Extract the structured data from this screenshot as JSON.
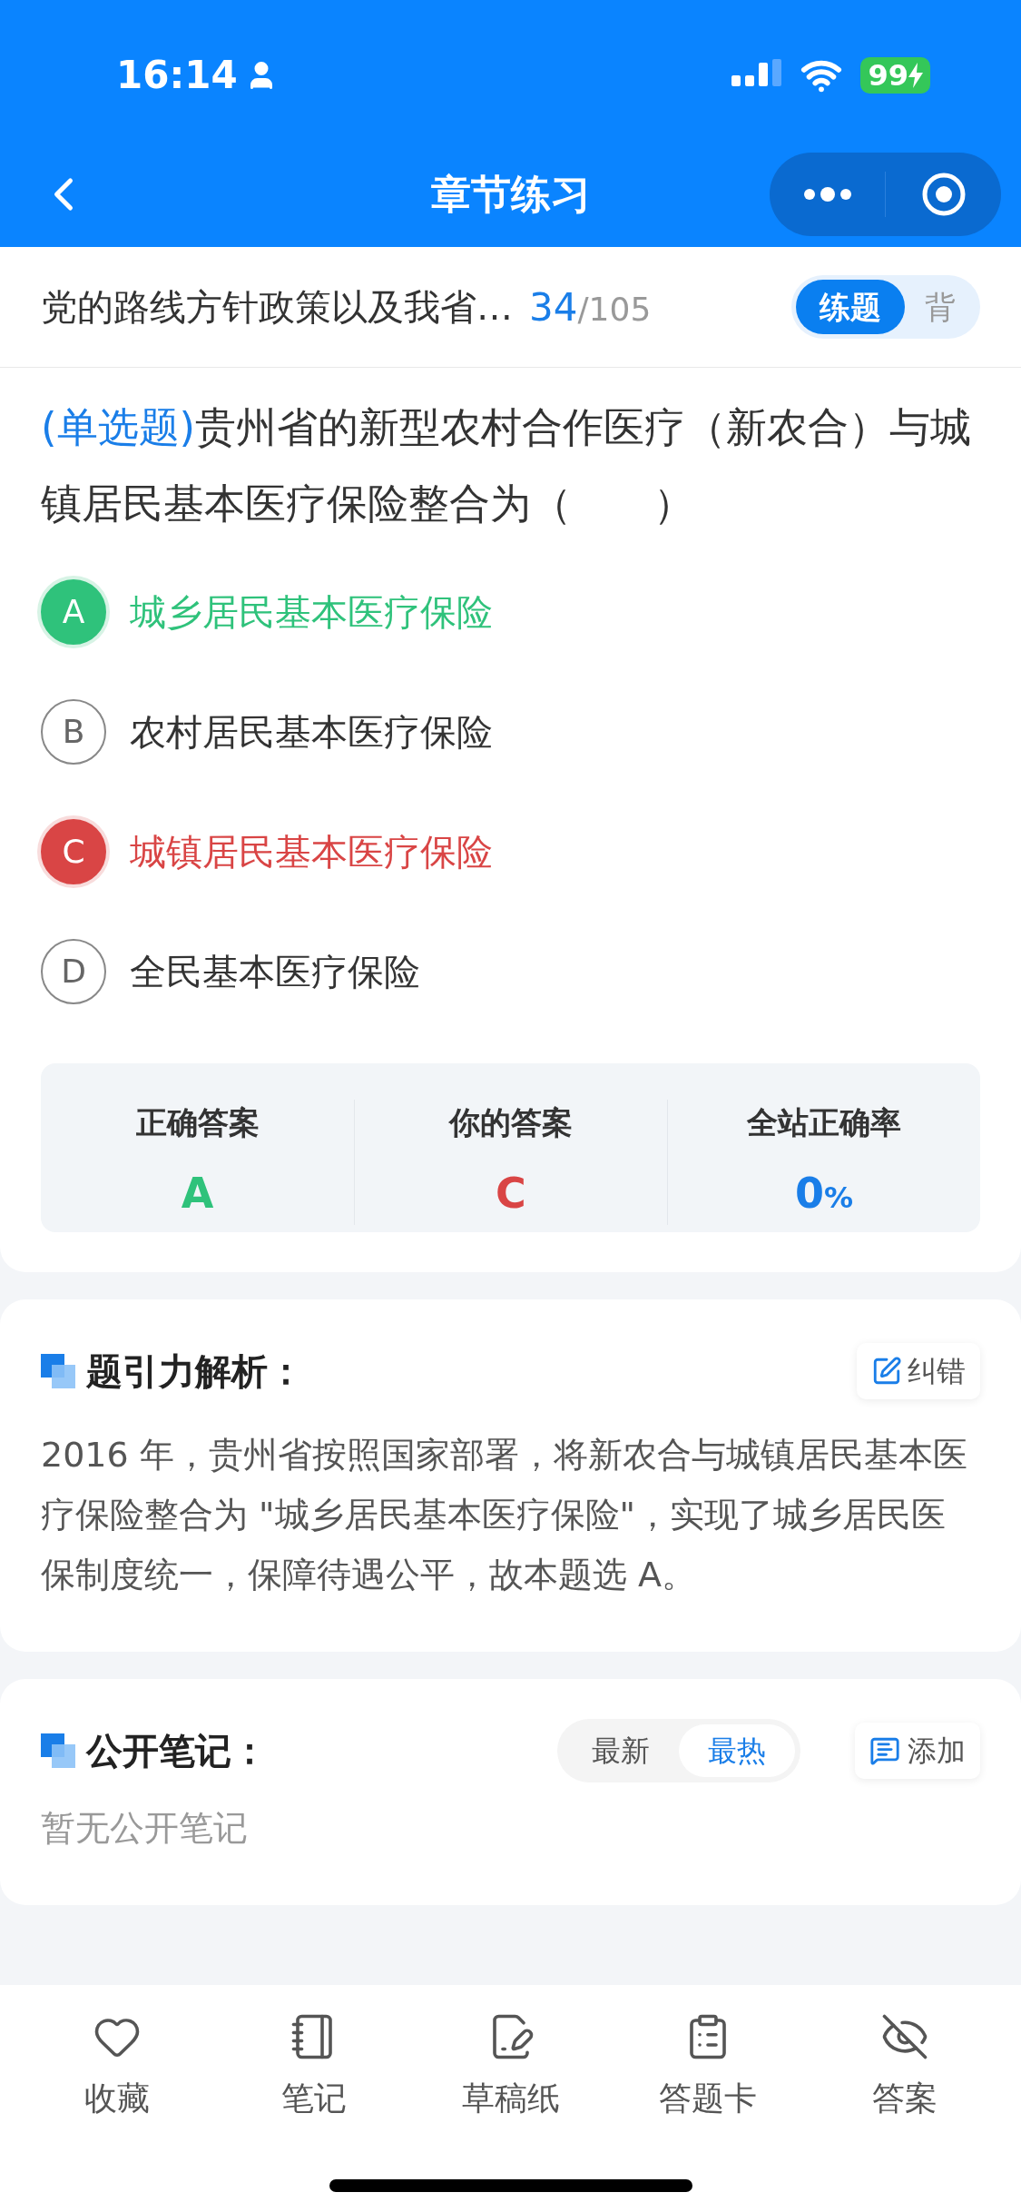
{
  "status_bar": {
    "time": "16:14",
    "battery": "99"
  },
  "nav": {
    "title": "章节练习"
  },
  "header": {
    "chapter": "党的路线方针政策以及我省…",
    "current": "34",
    "total": "/105",
    "modes": [
      {
        "label": "练题",
        "selected": true
      },
      {
        "label": "背",
        "selected": false
      }
    ]
  },
  "question": {
    "type": "(单选题)",
    "text": "贵州省的新型农村合作医疗（新农合）与城镇居民基本医疗保险整合为（　　）",
    "options": [
      {
        "letter": "A",
        "text": "城乡居民基本医疗保险",
        "kind": "correct"
      },
      {
        "letter": "B",
        "text": "农村居民基本医疗保险",
        "kind": "plain"
      },
      {
        "letter": "C",
        "text": "城镇居民基本医疗保险",
        "kind": "wrong"
      },
      {
        "letter": "D",
        "text": "全民基本医疗保险",
        "kind": "plain"
      }
    ]
  },
  "result": [
    {
      "label": "正确答案",
      "value": "A",
      "kind": "correct"
    },
    {
      "label": "你的答案",
      "value": "C",
      "kind": "wrong"
    },
    {
      "label": "全站正确率",
      "value": "0",
      "unit": "%",
      "kind": "rate"
    }
  ],
  "analysis": {
    "title": "题引力解析：",
    "action": "纠错",
    "text": "2016 年，贵州省按照国家部署，将新农合与城镇居民基本医疗保险整合为 \"城乡居民基本医疗保险\"，实现了城乡居民医保制度统一，保障待遇公平，故本题选 A。"
  },
  "notes": {
    "title": "公开笔记：",
    "sorts": [
      {
        "label": "最新",
        "selected": false
      },
      {
        "label": "最热",
        "selected": true
      }
    ],
    "action": "添加",
    "empty": "暂无公开笔记"
  },
  "toolbar": [
    {
      "label": "收藏",
      "kind": "heart"
    },
    {
      "label": "笔记",
      "kind": "notebook"
    },
    {
      "label": "草稿纸",
      "kind": "draft"
    },
    {
      "label": "答题卡",
      "kind": "card"
    },
    {
      "label": "答案",
      "kind": "eye"
    }
  ]
}
